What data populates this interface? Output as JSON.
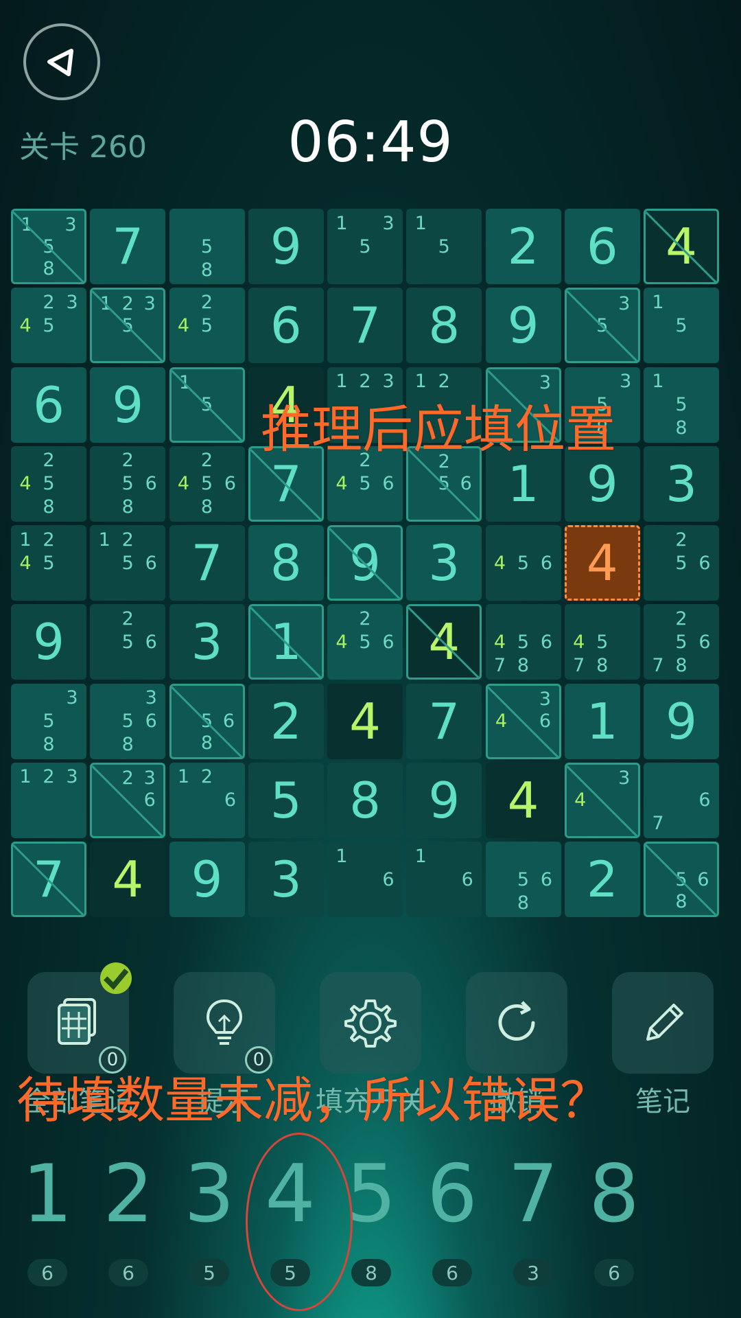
{
  "header": {
    "level": "关卡 260",
    "timer": "06:49"
  },
  "board": [
    [
      {
        "n": [
          1,
          3,
          5,
          8
        ],
        "crossed": true
      },
      {
        "v": 7
      },
      {
        "n": [
          5,
          8
        ]
      },
      {
        "v": 9
      },
      {
        "n": [
          1,
          3,
          5
        ]
      },
      {
        "n": [
          1,
          5
        ]
      },
      {
        "v": 2
      },
      {
        "v": 6
      },
      {
        "v": 4,
        "bright": true,
        "crossed": true,
        "dark": true
      }
    ],
    [
      {
        "n": [
          2,
          3,
          4,
          5
        ],
        "h": [
          4
        ]
      },
      {
        "n": [
          1,
          2,
          3,
          5
        ],
        "crossed": true
      },
      {
        "n": [
          2,
          4,
          5
        ],
        "h": [
          4
        ]
      },
      {
        "v": 6
      },
      {
        "v": 7
      },
      {
        "v": 8
      },
      {
        "v": 9
      },
      {
        "n": [
          3,
          5
        ],
        "crossed": true
      },
      {
        "n": [
          1,
          5
        ]
      }
    ],
    [
      {
        "v": 6
      },
      {
        "v": 9
      },
      {
        "n": [
          1,
          5
        ],
        "crossed": true
      },
      {
        "v": 4,
        "bright": true,
        "dark": true
      },
      {
        "n": [
          1,
          2,
          3
        ]
      },
      {
        "n": [
          1,
          2
        ]
      },
      {
        "n": [
          3
        ],
        "crossed": true
      },
      {
        "n": [
          3,
          5,
          8
        ]
      },
      {
        "n": [
          1,
          5,
          8
        ]
      }
    ],
    [
      {
        "n": [
          2,
          4,
          5,
          8
        ],
        "h": [
          4
        ]
      },
      {
        "n": [
          2,
          5,
          6,
          8
        ]
      },
      {
        "n": [
          2,
          4,
          5,
          6,
          8
        ],
        "h": [
          4
        ]
      },
      {
        "v": 7,
        "crossed": true
      },
      {
        "n": [
          2,
          4,
          5,
          6
        ],
        "h": [
          4
        ]
      },
      {
        "n": [
          2,
          5,
          6
        ],
        "crossed": true
      },
      {
        "v": 1
      },
      {
        "v": 9
      },
      {
        "v": 3
      }
    ],
    [
      {
        "n": [
          1,
          2,
          4,
          5
        ],
        "h": [
          4
        ]
      },
      {
        "n": [
          1,
          2,
          5,
          6
        ]
      },
      {
        "v": 7
      },
      {
        "v": 8
      },
      {
        "v": 9,
        "crossed": true
      },
      {
        "v": 3
      },
      {
        "n": [
          4,
          5,
          6
        ],
        "h": [
          4
        ]
      },
      {
        "v": 4,
        "sel": true
      },
      {
        "n": [
          2,
          5,
          6
        ]
      }
    ],
    [
      {
        "v": 9
      },
      {
        "n": [
          2,
          5,
          6
        ]
      },
      {
        "v": 3
      },
      {
        "v": 1,
        "crossed": true
      },
      {
        "n": [
          2,
          4,
          5,
          6
        ],
        "h": [
          4
        ]
      },
      {
        "v": 4,
        "bright": true,
        "crossed": true,
        "dark": true
      },
      {
        "n": [
          4,
          5,
          6,
          7,
          8
        ],
        "h": [
          4
        ]
      },
      {
        "n": [
          4,
          5,
          7,
          8
        ],
        "h": [
          4
        ]
      },
      {
        "n": [
          2,
          5,
          6,
          7,
          8
        ]
      }
    ],
    [
      {
        "n": [
          3,
          5,
          8
        ]
      },
      {
        "n": [
          3,
          5,
          6,
          8
        ]
      },
      {
        "n": [
          5,
          6,
          8
        ],
        "crossed": true
      },
      {
        "v": 2
      },
      {
        "v": 4,
        "bright": true,
        "dark": true
      },
      {
        "v": 7
      },
      {
        "n": [
          3,
          4,
          6
        ],
        "h": [
          4
        ],
        "crossed": true
      },
      {
        "v": 1
      },
      {
        "v": 9
      }
    ],
    [
      {
        "n": [
          1,
          2,
          3
        ]
      },
      {
        "n": [
          2,
          3,
          6
        ],
        "crossed": true
      },
      {
        "n": [
          1,
          2,
          6
        ]
      },
      {
        "v": 5
      },
      {
        "v": 8
      },
      {
        "v": 9
      },
      {
        "v": 4,
        "bright": true,
        "dark": true
      },
      {
        "n": [
          3,
          4
        ],
        "h": [
          4
        ],
        "crossed": true
      },
      {
        "n": [
          6,
          7
        ]
      }
    ],
    [
      {
        "v": 7,
        "crossed": true
      },
      {
        "v": 4,
        "bright": true,
        "dark": true
      },
      {
        "v": 9
      },
      {
        "v": 3
      },
      {
        "n": [
          1,
          6
        ]
      },
      {
        "n": [
          1,
          6
        ]
      },
      {
        "n": [
          5,
          6,
          8
        ]
      },
      {
        "v": 2
      },
      {
        "n": [
          5,
          6,
          8
        ],
        "crossed": true
      }
    ]
  ],
  "overlays": {
    "reason": "推理后应填位置",
    "question": "待填数量未减，所以错误？"
  },
  "toolbar": {
    "labels": [
      "全部笔记",
      "提示",
      "填充开关",
      "撤销",
      "笔记"
    ],
    "notes_badge": "0",
    "hint_badge": "0"
  },
  "numpad": [
    {
      "num": "1",
      "count": "6"
    },
    {
      "num": "2",
      "count": "6"
    },
    {
      "num": "3",
      "count": "5"
    },
    {
      "num": "4",
      "count": "5"
    },
    {
      "num": "5",
      "count": "8"
    },
    {
      "num": "6",
      "count": "6"
    },
    {
      "num": "7",
      "count": "3"
    },
    {
      "num": "8",
      "count": "6"
    }
  ],
  "colors": {
    "accent_overlay": "#ff6a2a",
    "digit": "#5fe0c5",
    "digit_bright": "#b8f56a",
    "selected_bg": "#7a3a0d"
  }
}
